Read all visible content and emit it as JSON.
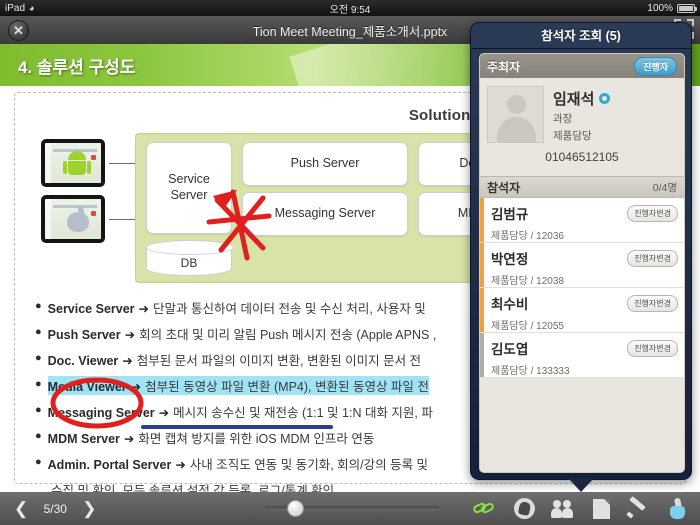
{
  "status_bar": {
    "device": "iPad",
    "wifi_icon": "wifi-icon",
    "time": "오전 9:54",
    "battery_percent": "100%",
    "battery_icon": "battery-icon"
  },
  "title_bar": {
    "close_icon": "close-icon",
    "document_title": "Tion Meet Meeting_제품소개서.pptx",
    "icons": [
      "note-icon",
      "chat-icon",
      "fullscreen-icon"
    ]
  },
  "slide": {
    "title": "4. 솔루션 구성도",
    "architecture_heading": "Solution Architecture",
    "devices": [
      {
        "name": "android-device",
        "icon": "android-icon"
      },
      {
        "name": "ios-device",
        "icon": "apple-icon"
      }
    ],
    "boxes": {
      "service_server": "Service\nServer",
      "service_server_line1": "Service",
      "service_server_line2": "Server",
      "database": "DB",
      "push_server": "Push Server",
      "messaging_server": "Messaging Server",
      "doc_viewer": "Doc. Viewer",
      "mdm_server": "MDM Server"
    },
    "bullets": [
      {
        "term": "Service Server",
        "arrow": "➜",
        "desc": "단말과 통신하여 데이터 전송 및 수신 처리, 사용자 및",
        "highlight": false,
        "annotation": "red-circle"
      },
      {
        "term": "Push Server",
        "arrow": "➜",
        "desc": "회의 초대 및 미리 알림 Push 메시지 전송 (Apple APNS ,",
        "highlight": false,
        "annotation": "blue-underline"
      },
      {
        "term": "Doc. Viewer",
        "arrow": "➜",
        "desc": "첨부된 문서 파일의 이미지 변환, 변환된 이미지 문서 전",
        "highlight": false,
        "annotation": ""
      },
      {
        "term": "Media Viewer",
        "arrow": "➜",
        "desc": "첨부된 동영상 파일 변환 (MP4), 변환된 동영상 파일 전",
        "highlight": true,
        "annotation": ""
      },
      {
        "term": "Messaging Server",
        "arrow": "➜",
        "desc": "메시지 송수신 및 재전송 (1:1 및 1:N 대화 지원, 파",
        "highlight": false,
        "annotation": ""
      },
      {
        "term": "MDM Server",
        "arrow": "➜",
        "desc": "화면 캡쳐 방지를 위한 iOS MDM 인프라 연동",
        "highlight": false,
        "annotation": ""
      },
      {
        "term": "Admin. Portal Server",
        "arrow": "➜",
        "desc": "사내 조직도 연동 및 동기화, 회의/강의 등록 및",
        "highlight": false,
        "annotation": ""
      }
    ],
    "bullet_continuation": "수집 및 확인, 모든 솔루션 설정 값 등록, 로그/통계 확인"
  },
  "panel": {
    "title": "참석자 조회 (5)",
    "host_section": {
      "label": "주최자",
      "badge": "진행자",
      "avatar_icon": "person-avatar-icon",
      "name": "임재석",
      "status_icon": "online-status-icon",
      "rank": "과장",
      "department": "제품담당",
      "phone": "01046512105"
    },
    "participant_section": {
      "label": "참석자",
      "count": "0/4명",
      "rows": [
        {
          "name": "김범규",
          "detail": "제품담당 / 12036",
          "button": "진행자변경",
          "bar_color": "#f2a03c"
        },
        {
          "name": "박연정",
          "detail": "제품담당 / 12038",
          "button": "진행자변경",
          "bar_color": "#f2a03c"
        },
        {
          "name": "최수비",
          "detail": "제품담당 / 12055",
          "button": "진행자변경",
          "bar_color": "#f2a03c"
        },
        {
          "name": "김도엽",
          "detail": "제품담당 / 133333",
          "button": "진행자변경",
          "bar_color": "#b0aca6"
        }
      ]
    }
  },
  "bottom_bar": {
    "prev_icon": "chevron-left-icon",
    "page_indicator": "5/30",
    "next_icon": "chevron-right-icon",
    "tools": [
      {
        "name": "link-icon",
        "label": "link"
      },
      {
        "name": "hand-icon",
        "label": "hand"
      },
      {
        "name": "people-icon",
        "label": "people"
      },
      {
        "name": "document-icon",
        "label": "document"
      },
      {
        "name": "pencil-icon",
        "label": "pencil"
      },
      {
        "name": "touch-pointer-icon",
        "label": "pointer"
      }
    ]
  },
  "colors": {
    "slide_header_green": "#8cc63f",
    "panel_navy": "#15203a",
    "badge_blue": "#3e9cc9",
    "participant_bar_orange": "#f2a03c",
    "annotation_red": "#e01f1f",
    "annotation_blue": "#2b3f8f",
    "highlight_cyan": "#9fe3f5",
    "link_green": "#8ae23b"
  }
}
